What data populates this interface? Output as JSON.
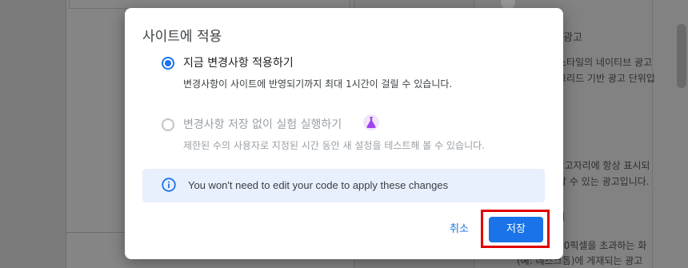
{
  "background": {
    "right_texts": [
      "광고",
      "스타일의 네이티브 광고",
      "그리드 기반 광고 단위입",
      "h 광고자리에 항상 표시되",
      "할 수 있는 광고입니다.",
      "I",
      "1,000픽셀을 초과하는 화",
      "(예: 데스크톱)에 게재되는 광고"
    ]
  },
  "dialog": {
    "title": "사이트에 적용",
    "options": [
      {
        "label": "지금 변경사항 적용하기",
        "description": "변경사항이 사이트에 반영되기까지 최대 1시간이 걸릴 수 있습니다.",
        "selected": true
      },
      {
        "label": "변경사항 저장 없이 실험 실행하기",
        "description": "제한된 수의 사용자로 지정된 시간 동안 새 설정을 테스트해 볼 수 있습니다.",
        "selected": false,
        "badge_icon": "flask-icon"
      }
    ],
    "info": {
      "icon": "info-icon",
      "text": "You won't need to edit your code to apply these changes"
    },
    "buttons": {
      "cancel": "취소",
      "save": "저장"
    },
    "colors": {
      "accent": "#1a73e8",
      "highlight": "#e00000",
      "info_bg": "#e8f0fe"
    }
  }
}
